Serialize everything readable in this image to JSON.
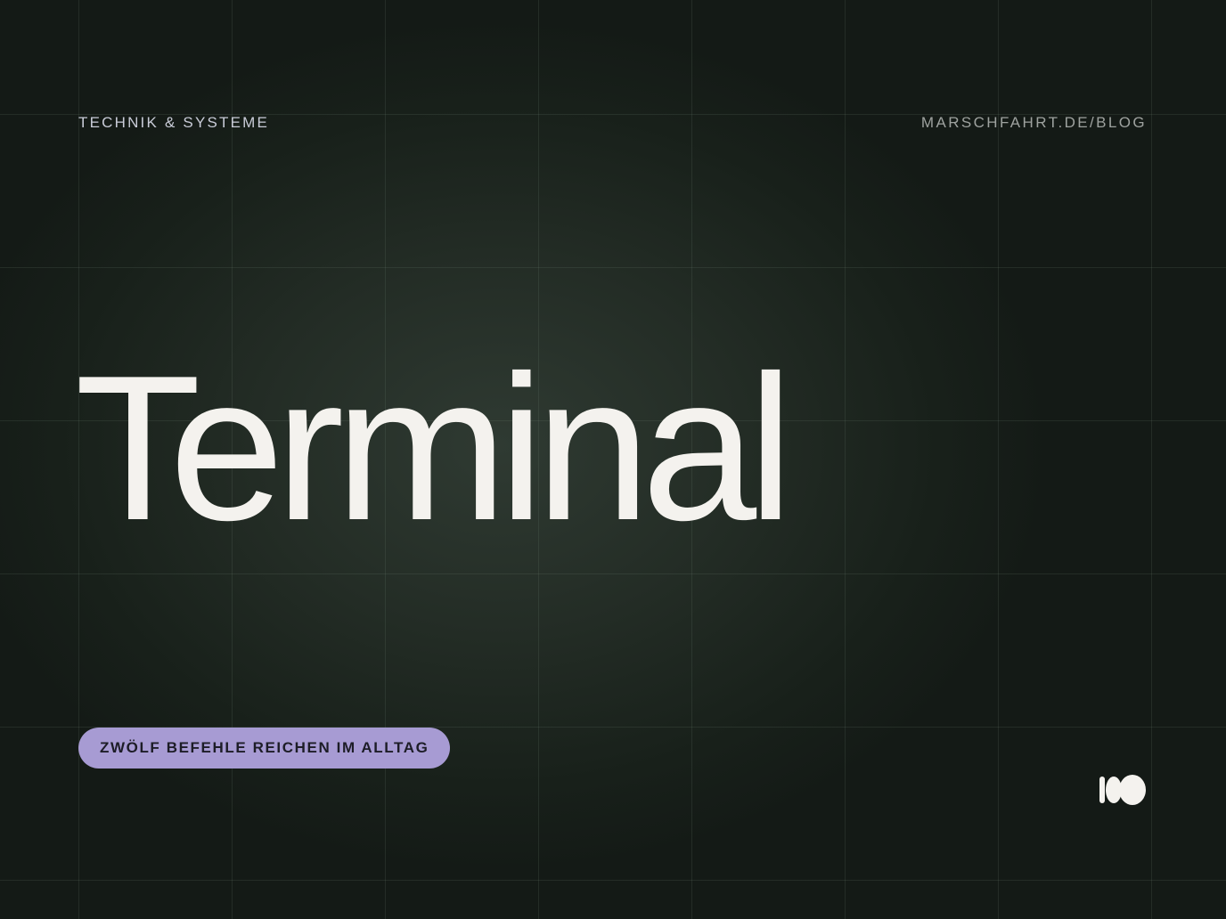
{
  "header": {
    "category": "TECHNIK & SYSTEME",
    "site": "MARSCHFAHRT.DE/BLOG"
  },
  "main": {
    "title": "Terminal",
    "tagline": "ZWÖLF BEFEHLE REICHEN IM ALLTAG"
  },
  "logo": {
    "icon": "brand-mark-icon"
  },
  "colors": {
    "background": "#1a211c",
    "title": "#f4f2ee",
    "pill": "#a79bd3",
    "category_text": "#c9ccd8",
    "site_text": "#9ea29f"
  }
}
